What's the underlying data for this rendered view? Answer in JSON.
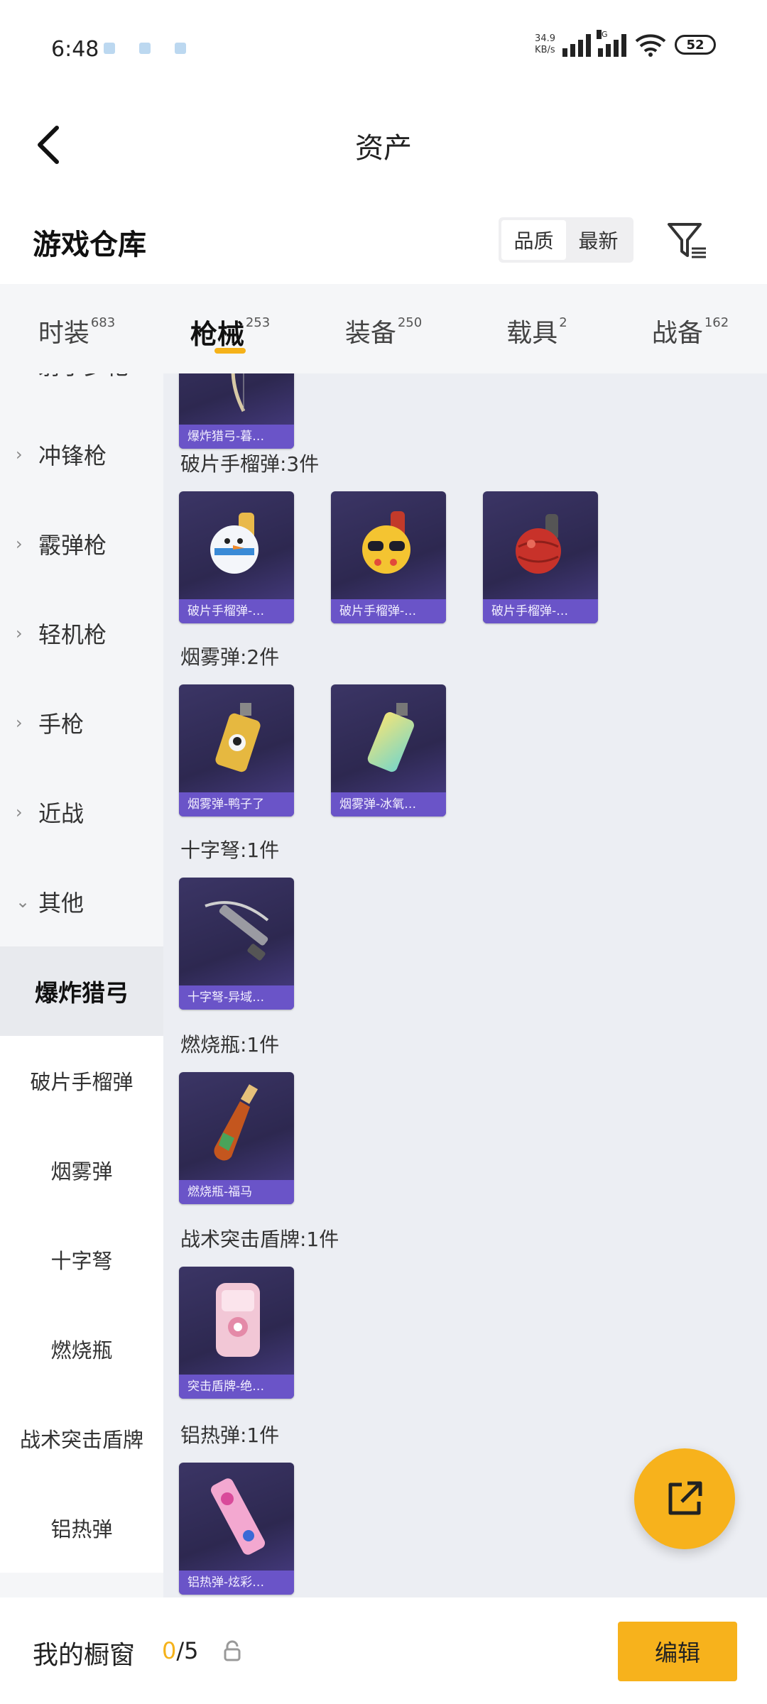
{
  "status_bar": {
    "time": "6:48",
    "speed_value": "34.9",
    "speed_unit": "KB/s",
    "network": "5G",
    "battery": "52"
  },
  "header": {
    "title": "资产"
  },
  "warehouse": {
    "title": "游戏仓库",
    "sort_options": [
      "品质",
      "最新"
    ],
    "active_sort": "品质"
  },
  "tabs": [
    {
      "label": "时装",
      "count": "683"
    },
    {
      "label": "枪械",
      "count": "253",
      "active": true
    },
    {
      "label": "装备",
      "count": "250"
    },
    {
      "label": "载具",
      "count": "2"
    },
    {
      "label": "战备",
      "count": "162"
    }
  ],
  "sidebar": {
    "categories": [
      "射手步枪",
      "冲锋枪",
      "霰弹枪",
      "轻机枪",
      "手枪",
      "近战",
      "其他"
    ],
    "subcategories": [
      "爆炸猎弓",
      "破片手榴弹",
      "烟雾弹",
      "十字弩",
      "燃烧瓶",
      "战术突击盾牌",
      "铝热弹"
    ],
    "active_sub": "爆炸猎弓"
  },
  "groups": [
    {
      "title": "",
      "items": [
        {
          "label": "爆炸猎弓-暮…",
          "icon": "bow-icon"
        }
      ]
    },
    {
      "title": "破片手榴弹:3件",
      "items": [
        {
          "label": "破片手榴弹-…",
          "icon": "snowman-grenade-icon"
        },
        {
          "label": "破片手榴弹-…",
          "icon": "emoji-grenade-icon"
        },
        {
          "label": "破片手榴弹-…",
          "icon": "red-grenade-icon"
        }
      ]
    },
    {
      "title": "烟雾弹:2件",
      "items": [
        {
          "label": "烟雾弹-鸭子了",
          "icon": "penguin-smoke-icon"
        },
        {
          "label": "烟雾弹-冰氧…",
          "icon": "mint-smoke-icon"
        }
      ]
    },
    {
      "title": "十字弩:1件",
      "items": [
        {
          "label": "十字弩-异域…",
          "icon": "crossbow-icon"
        }
      ]
    },
    {
      "title": "燃烧瓶:1件",
      "items": [
        {
          "label": "燃烧瓶-福马",
          "icon": "molotov-icon"
        }
      ]
    },
    {
      "title": "战术突击盾牌:1件",
      "items": [
        {
          "label": "突击盾牌-绝…",
          "icon": "shield-icon"
        }
      ]
    },
    {
      "title": "铝热弹:1件",
      "items": [
        {
          "label": "铝热弹-炫彩…",
          "icon": "thermite-icon"
        }
      ]
    }
  ],
  "bottom_bar": {
    "label": "我的橱窗",
    "current": "0",
    "total": "/5",
    "edit_label": "编辑"
  },
  "colors": {
    "accent": "#f7b21c",
    "card_bg": "#2d2850",
    "card_label": "#6a54c8",
    "content_bg": "#eceef3",
    "sidebar_bg": "#f5f6f8"
  }
}
